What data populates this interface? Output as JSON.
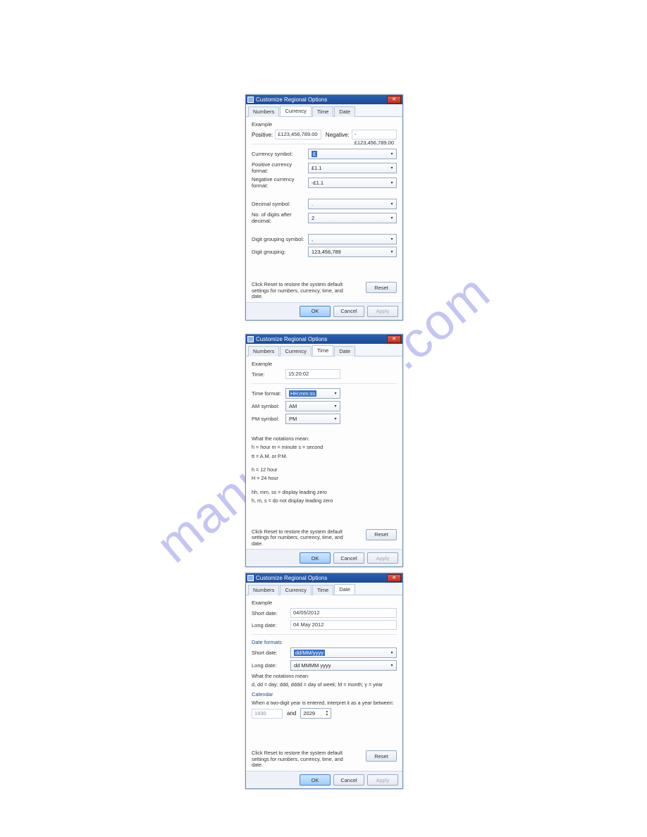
{
  "watermark": "manualshive.com",
  "common": {
    "title": "Customize Regional Options",
    "tabs": {
      "numbers": "Numbers",
      "currency": "Currency",
      "time": "Time",
      "date": "Date"
    },
    "example": "Example",
    "reset_text": "Click Reset to restore the system default settings for numbers, currency, time, and date.",
    "buttons": {
      "reset": "Reset",
      "ok": "OK",
      "cancel": "Cancel",
      "apply": "Apply"
    }
  },
  "currency": {
    "positive_label": "Positive:",
    "positive_value": "£123,456,789.00",
    "negative_label": "Negative:",
    "negative_value": "-£123,456,789.00",
    "rows": {
      "currency_symbol": {
        "label": "Currency symbol:",
        "value": "£"
      },
      "positive_format": {
        "label": "Positive currency format:",
        "value": "£1.1"
      },
      "negative_format": {
        "label": "Negative currency format:",
        "value": "-£1.1"
      },
      "decimal_symbol": {
        "label": "Decimal symbol:",
        "value": "."
      },
      "digits_after": {
        "label": "No. of digits after decimal:",
        "value": "2"
      },
      "group_symbol": {
        "label": "Digit grouping symbol:",
        "value": ","
      },
      "grouping": {
        "label": "Digit grouping:",
        "value": "123,456,789"
      }
    }
  },
  "time": {
    "time_label": "Time:",
    "time_value": "15:20:02",
    "rows": {
      "format": {
        "label": "Time format:",
        "value": "HH:mm:ss"
      },
      "am": {
        "label": "AM symbol:",
        "value": "AM"
      },
      "pm": {
        "label": "PM symbol:",
        "value": "PM"
      }
    },
    "notations_title": "What the notations mean:",
    "line1": "h = hour   m = minute   s = second",
    "line2": "tt = A.M. or P.M.",
    "line3": "h = 12 hour",
    "line4": "H = 24 hour",
    "line5": "hh, mm, ss = display leading zero",
    "line6": "h, m, s = do not display leading zero"
  },
  "date": {
    "short_label": "Short date:",
    "short_value": "04/05/2012",
    "long_label": "Long date:",
    "long_value": "04 May 2012",
    "formats_title": "Date formats",
    "short_fmt_label": "Short date:",
    "short_fmt_value": "dd/MM/yyyy",
    "long_fmt_label": "Long date:",
    "long_fmt_value": "dd MMMM yyyy",
    "notations_title": "What the notations mean:",
    "notations_text": "d, dd = day;  ddd, dddd = day of week;  M = month;  y = year",
    "calendar_title": "Calendar",
    "calendar_text": "When a two-digit year is entered, interpret it as a year between:",
    "year_from": "1930",
    "year_and": "and",
    "year_to": "2029"
  }
}
